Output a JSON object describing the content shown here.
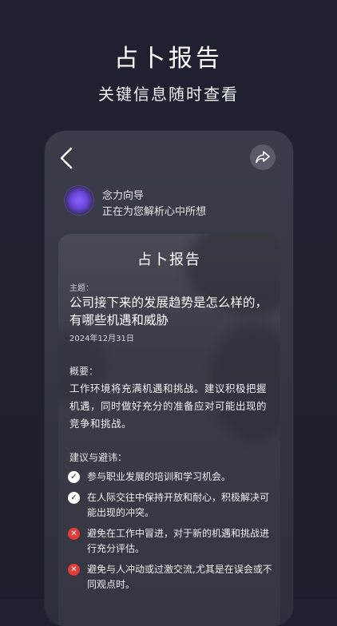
{
  "hero": {
    "title": "占卜报告",
    "subtitle": "关键信息随时查看"
  },
  "header": {
    "back_icon": "chevron-left-icon",
    "share_icon": "share-arrow-icon"
  },
  "guide": {
    "name": "念力向导",
    "status": "正在为您解析心中所想"
  },
  "report": {
    "title": "占卜报告",
    "topic_label": "主题：",
    "topic": "公司接下来的发展趋势是怎么样的，有哪些机遇和威胁",
    "date": "2024年12月31日",
    "overview_label": "概要：",
    "overview": "工作环境将充满机遇和挑战。建议积极把握机遇，同时做好充分的准备应对可能出现的竞争和挑战。",
    "advice_label": "建议与避讳：",
    "advice": [
      {
        "type": "do",
        "icon": "check-circle-icon",
        "text": "参与职业发展的培训和学习机会。"
      },
      {
        "type": "do",
        "icon": "check-circle-icon",
        "text": "在人际交往中保持开放和耐心，积极解决可能出现的冲突。"
      },
      {
        "type": "avoid",
        "icon": "cross-circle-icon",
        "text": "避免在工作中冒进，对于新的机遇和挑战进行充分评估。"
      },
      {
        "type": "avoid",
        "icon": "cross-circle-icon",
        "text": "避免与人冲动或过激交流,尤其是在误会或不同观点时。"
      }
    ]
  },
  "colors": {
    "background": "#1f2030",
    "card": "#3b3c4a",
    "accent_purple": "#7b55f0",
    "check": "#ffffff",
    "cross": "#e23b3b"
  }
}
